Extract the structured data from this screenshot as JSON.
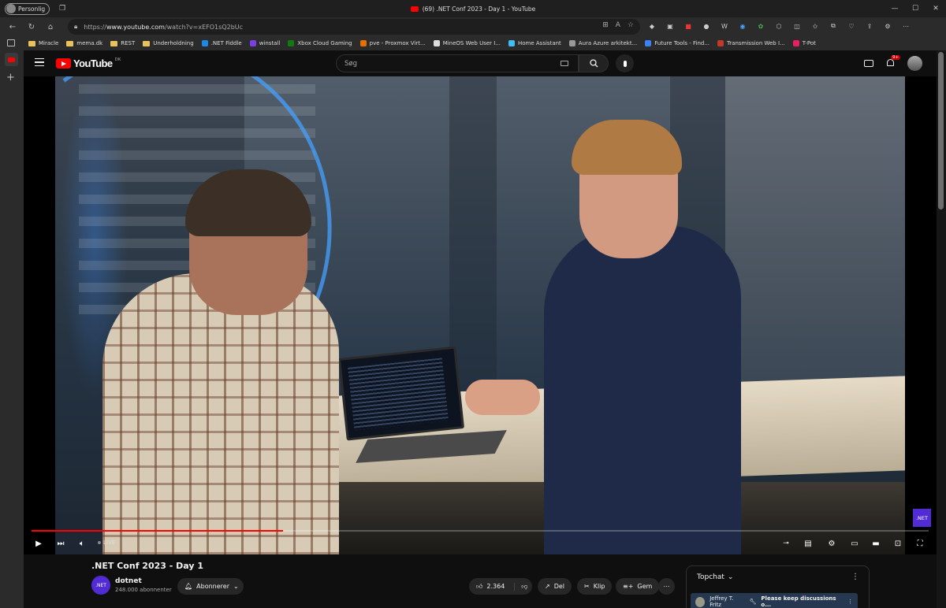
{
  "browser": {
    "profile_label": "Personlig",
    "window_title": "(69) .NET Conf 2023 - Day 1 - YouTube",
    "url_prefix": "https://",
    "url_host": "www.youtube.com",
    "url_path": "/watch?v=xEFO1sQ2bUc",
    "bookmarks": [
      {
        "label": "Miracle",
        "icon": "folder-icon"
      },
      {
        "label": "mema.dk",
        "icon": "folder-icon"
      },
      {
        "label": "REST",
        "icon": "folder-icon"
      },
      {
        "label": "Underholdning",
        "icon": "folder-icon"
      },
      {
        "label": ".NET Fiddle",
        "icon": "site-icon",
        "color": "#1e88e5"
      },
      {
        "label": "winstall",
        "icon": "site-icon",
        "color": "#7b3fe4"
      },
      {
        "label": "Xbox Cloud Gaming",
        "icon": "site-icon",
        "color": "#107c10"
      },
      {
        "label": "pve - Proxmox Virt...",
        "icon": "site-icon",
        "color": "#e57000"
      },
      {
        "label": "MineOS Web User I...",
        "icon": "page-icon",
        "color": "#dddddd"
      },
      {
        "label": "Home Assistant",
        "icon": "site-icon",
        "color": "#41bdf5"
      },
      {
        "label": "Aura Azure arkitekt...",
        "icon": "site-icon",
        "color": "#999999"
      },
      {
        "label": "Future Tools - Find...",
        "icon": "site-icon",
        "color": "#3b82f6"
      },
      {
        "label": "Transmission Web I...",
        "icon": "site-icon",
        "color": "#c0392b"
      },
      {
        "label": "T-Pot",
        "icon": "site-icon",
        "color": "#e91e63"
      }
    ]
  },
  "youtube": {
    "logo_text": "YouTube",
    "country_code": "DK",
    "search_placeholder": "Søg",
    "notification_count": "9+",
    "video": {
      "title": ".NET Conf 2023 - Day 1",
      "live_label": "LIVE",
      "overlay_badge": ".NET",
      "progress_fraction": 0.28
    },
    "channel": {
      "avatar_text": ".NET",
      "name": "dotnet",
      "subscribers": "248.000 abonnenter",
      "subscribe_label": "Abonnerer"
    },
    "actions": {
      "likes": "2.364",
      "share": "Del",
      "clip": "Klip",
      "save": "Gem"
    },
    "chat": {
      "header": "Topchat",
      "pinned_author": "Jeffrey T. Fritz",
      "pinned_text": "Please keep discussions o..."
    }
  },
  "colors": {
    "accent_red": "#ff0000",
    "dotnet_purple": "#512bd4"
  }
}
